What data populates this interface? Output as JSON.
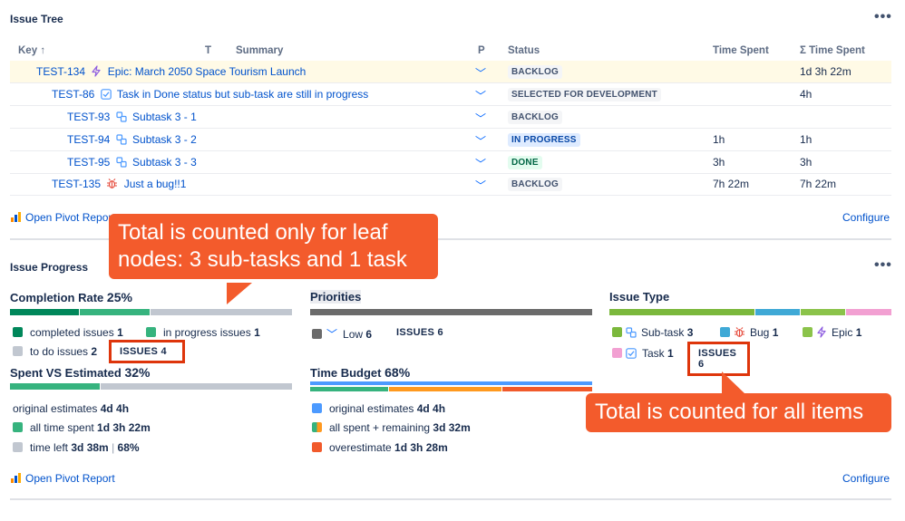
{
  "issue_tree": {
    "title": "Issue Tree",
    "more_label": "•••",
    "columns": {
      "key": "Key",
      "sort_arrow": "↑",
      "type": "T",
      "summary": "Summary",
      "priority": "P",
      "status": "Status",
      "time_spent": "Time Spent",
      "sum_time_spent": "Σ Time Spent"
    },
    "rows": [
      {
        "key": "TEST-134",
        "icon": "epic-icon",
        "summary": "Epic: March 2050 Space Tourism Launch",
        "priority": "﹀",
        "status": "BACKLOG",
        "time_spent": "",
        "sum_time_spent": "1d 3h 22m"
      },
      {
        "key": "TEST-86",
        "icon": "task-icon",
        "summary": "Task in Done status but sub-task are still in progress",
        "priority": "﹀",
        "status": "SELECTED FOR DEVELOPMENT",
        "time_spent": "",
        "sum_time_spent": "4h"
      },
      {
        "key": "TEST-93",
        "icon": "subtask-icon",
        "summary": "Subtask 3 - 1",
        "priority": "﹀",
        "status": "BACKLOG",
        "time_spent": "",
        "sum_time_spent": ""
      },
      {
        "key": "TEST-94",
        "icon": "subtask-icon",
        "summary": "Subtask 3 - 2",
        "priority": "﹀",
        "status": "IN PROGRESS",
        "time_spent": "1h",
        "sum_time_spent": "1h"
      },
      {
        "key": "TEST-95",
        "icon": "subtask-icon",
        "summary": "Subtask 3 - 3",
        "priority": "﹀",
        "status": "DONE",
        "time_spent": "3h",
        "sum_time_spent": "3h"
      },
      {
        "key": "TEST-135",
        "icon": "bug-icon",
        "summary": "Just a bug!!1",
        "priority": "﹀",
        "status": "BACKLOG",
        "time_spent": "7h 22m",
        "sum_time_spent": "7h 22m"
      }
    ],
    "open_pivot": "Open Pivot Report",
    "configure": "Configure"
  },
  "issue_progress": {
    "title": "Issue Progress",
    "more_label": "•••",
    "completion": {
      "title": "Completion Rate",
      "value": "25%",
      "completed_label": "completed issues",
      "completed_count": "1",
      "in_progress_label": "in progress issues",
      "in_progress_count": "1",
      "todo_label": "to do issues",
      "todo_count": "2",
      "issues_label": "ISSUES 4"
    },
    "priorities": {
      "title": "Priorities",
      "low_label": "Low",
      "low_count": "6",
      "issues_label": "ISSUES 6"
    },
    "issue_type": {
      "title": "Issue Type",
      "subtask_label": "Sub-task",
      "subtask_count": "3",
      "bug_label": "Bug",
      "bug_count": "1",
      "epic_label": "Epic",
      "epic_count": "1",
      "task_label": "Task",
      "task_count": "1",
      "issues_label": "ISSUES 6"
    },
    "spent_vs_estimated": {
      "title": "Spent VS Estimated",
      "value": "32%",
      "original_label": "original estimates",
      "original_value": "4d 4h",
      "all_spent_label": "all time spent",
      "all_spent_value": "1d 3h 22m",
      "time_left_label": "time left",
      "time_left_value": "3d 38m",
      "time_left_pct": "68%"
    },
    "time_budget": {
      "title": "Time Budget",
      "value": "68%",
      "original_label": "original estimates",
      "original_value": "4d 4h",
      "all_spent_label": "all spent + remaining",
      "all_spent_value": "3d 32m",
      "overestimate_label": "overestimate",
      "overestimate_value": "1d 3h 28m"
    },
    "open_pivot": "Open Pivot Report",
    "configure": "Configure"
  },
  "callouts": {
    "leaf": "Total is counted only for leaf nodes: 3 sub-tasks and 1 task",
    "all": "Total is counted for all items"
  },
  "colors": {
    "done": "#00875a",
    "in_progress": "#36b37e",
    "todo": "#c1c7d0",
    "accent_link": "#0052cc",
    "callout": "#f35b2c",
    "highlight": "#de350b"
  }
}
